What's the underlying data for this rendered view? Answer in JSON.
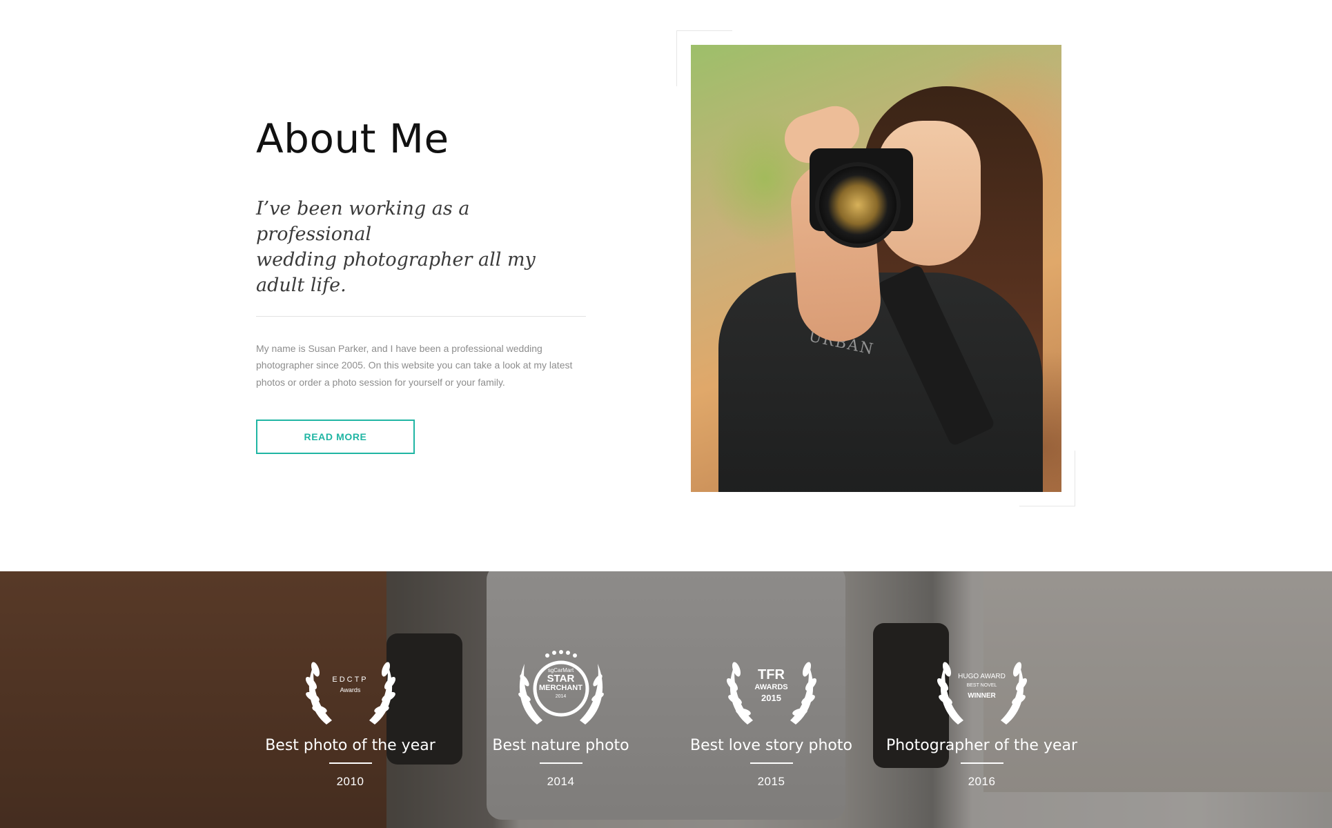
{
  "about": {
    "title": "About Me",
    "lead_lines": [
      "I’ve been working as a professional",
      "wedding photographer all my adult life."
    ],
    "body_lines": [
      "My name is Susan Parker, and I have been a professional wedding",
      "photographer since 2005. On this website you can take a look at my latest",
      "photos or order a photo session for yourself or your family."
    ],
    "button_label": "READ MORE",
    "accent_color": "#1fb5a3",
    "photo_shirt_text": "URBAN"
  },
  "awards": {
    "items": [
      {
        "icon": "laurel-wreath-icon",
        "badge_lines": [
          "EDCTP",
          "Awards"
        ],
        "title": "Best photo of the year",
        "year": "2010"
      },
      {
        "icon": "laurel-wreath-icon",
        "badge_lines": [
          "sgCarMart",
          "STAR",
          "MERCHANT",
          "2014"
        ],
        "title": "Best nature photo",
        "year": "2014"
      },
      {
        "icon": "laurel-wreath-icon",
        "badge_lines": [
          "TFR",
          "AWARDS",
          "2015"
        ],
        "title": "Best love story photo",
        "year": "2015"
      },
      {
        "icon": "laurel-wreath-icon",
        "badge_lines": [
          "HUGO AWARD",
          "BEST NOVEL",
          "WINNER"
        ],
        "title": "Photographer of the year",
        "year": "2016"
      }
    ]
  }
}
